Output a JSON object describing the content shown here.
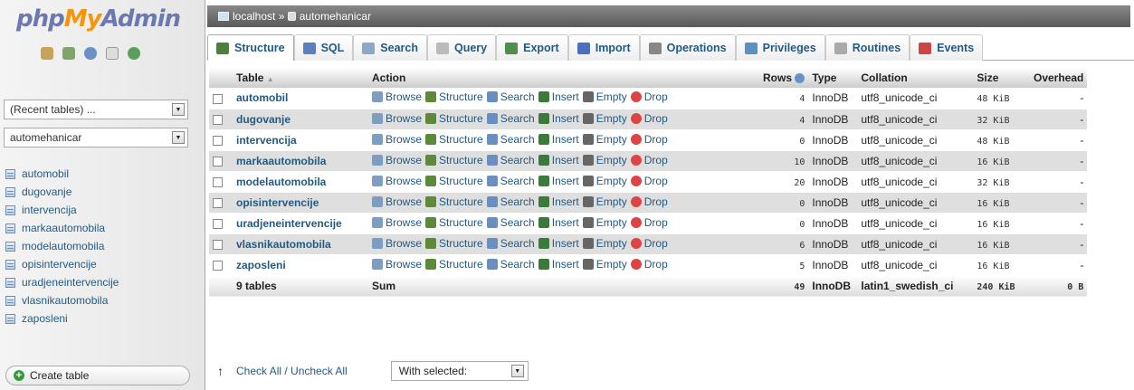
{
  "logo": {
    "p1": "php",
    "p2": "My",
    "p3": "Admin"
  },
  "nav_icons": [
    "home-icon",
    "logout-icon",
    "help-icon",
    "docs-icon",
    "reload-icon"
  ],
  "recent": "(Recent tables) ...",
  "db_select": "automehanicar",
  "sidebar_tables": [
    "automobil",
    "dugovanje",
    "intervencija",
    "markaautomobila",
    "modelautomobila",
    "opisintervencije",
    "uradjeneintervencije",
    "vlasnikautomobila",
    "zaposleni"
  ],
  "create_table": "Create table",
  "breadcrumb": {
    "server": "localhost",
    "sep": " » ",
    "db": "automehanicar"
  },
  "tabs": [
    {
      "label": "Structure",
      "icon": "structure-icon"
    },
    {
      "label": "SQL",
      "icon": "sql-icon"
    },
    {
      "label": "Search",
      "icon": "search-icon"
    },
    {
      "label": "Query",
      "icon": "query-icon"
    },
    {
      "label": "Export",
      "icon": "export-icon"
    },
    {
      "label": "Import",
      "icon": "import-icon"
    },
    {
      "label": "Operations",
      "icon": "wrench-icon"
    },
    {
      "label": "Privileges",
      "icon": "privileges-icon"
    },
    {
      "label": "Routines",
      "icon": "routines-icon"
    },
    {
      "label": "Events",
      "icon": "clock-icon"
    }
  ],
  "headers": {
    "table": "Table",
    "sort": "▲",
    "action": "Action",
    "rows": "Rows",
    "type": "Type",
    "collation": "Collation",
    "size": "Size",
    "overhead": "Overhead"
  },
  "actions": [
    "Browse",
    "Structure",
    "Search",
    "Insert",
    "Empty",
    "Drop"
  ],
  "rows": [
    {
      "name": "automobil",
      "rows": "4",
      "type": "InnoDB",
      "collation": "utf8_unicode_ci",
      "size": "48 KiB",
      "overhead": "-"
    },
    {
      "name": "dugovanje",
      "rows": "4",
      "type": "InnoDB",
      "collation": "utf8_unicode_ci",
      "size": "32 KiB",
      "overhead": "-"
    },
    {
      "name": "intervencija",
      "rows": "0",
      "type": "InnoDB",
      "collation": "utf8_unicode_ci",
      "size": "48 KiB",
      "overhead": "-"
    },
    {
      "name": "markaautomobila",
      "rows": "10",
      "type": "InnoDB",
      "collation": "utf8_unicode_ci",
      "size": "16 KiB",
      "overhead": "-"
    },
    {
      "name": "modelautomobila",
      "rows": "20",
      "type": "InnoDB",
      "collation": "utf8_unicode_ci",
      "size": "32 KiB",
      "overhead": "-"
    },
    {
      "name": "opisintervencije",
      "rows": "0",
      "type": "InnoDB",
      "collation": "utf8_unicode_ci",
      "size": "16 KiB",
      "overhead": "-"
    },
    {
      "name": "uradjeneintervencije",
      "rows": "0",
      "type": "InnoDB",
      "collation": "utf8_unicode_ci",
      "size": "16 KiB",
      "overhead": "-"
    },
    {
      "name": "vlasnikautomobila",
      "rows": "6",
      "type": "InnoDB",
      "collation": "utf8_unicode_ci",
      "size": "16 KiB",
      "overhead": "-"
    },
    {
      "name": "zaposleni",
      "rows": "5",
      "type": "InnoDB",
      "collation": "utf8_unicode_ci",
      "size": "16 KiB",
      "overhead": "-"
    }
  ],
  "footer": {
    "count": "9 tables",
    "sum": "Sum",
    "rows": "49",
    "type": "InnoDB",
    "collation": "latin1_swedish_ci",
    "size": "240 KiB",
    "overhead": "0 B"
  },
  "bottom": {
    "check_all": "Check All / Uncheck All",
    "with_selected": "With selected:"
  }
}
